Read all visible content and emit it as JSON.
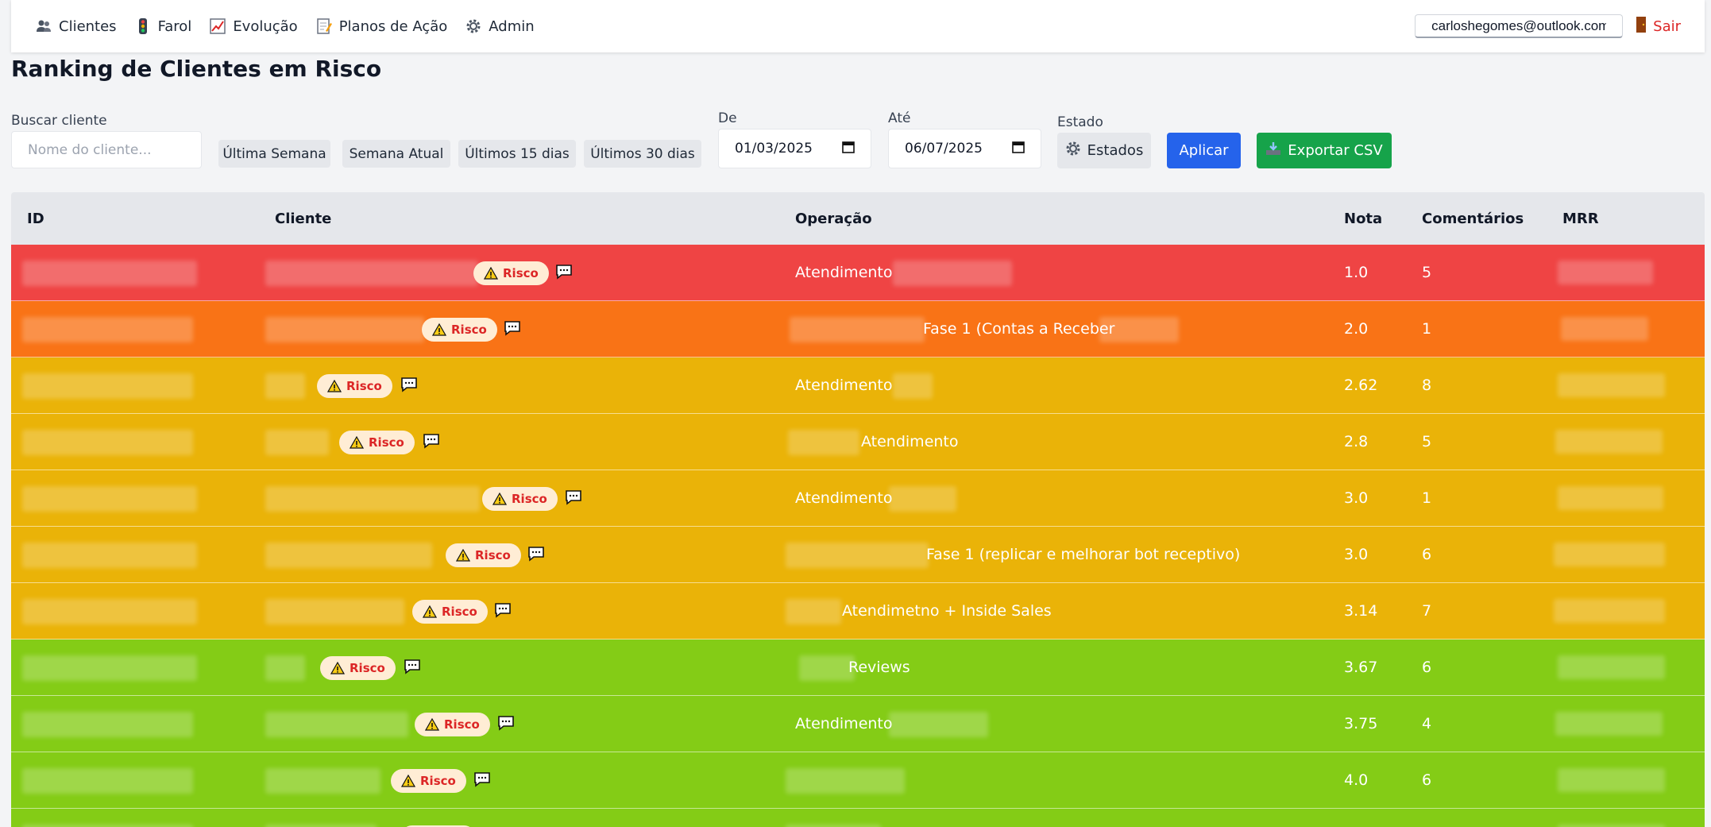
{
  "nav": {
    "items": [
      {
        "label": "Clientes",
        "icon": "users-icon"
      },
      {
        "label": "Farol",
        "icon": "traffic-light-icon"
      },
      {
        "label": "Evolução",
        "icon": "chart-icon"
      },
      {
        "label": "Planos de Ação",
        "icon": "memo-icon"
      },
      {
        "label": "Admin",
        "icon": "gear-icon"
      }
    ],
    "user_email": "carloshegomes@outlook.com",
    "logout_label": "Sair"
  },
  "page": {
    "title": "Ranking de Clientes em Risco"
  },
  "filters": {
    "search_label": "Buscar cliente",
    "search_placeholder": "Nome do cliente...",
    "quick_ranges": [
      "Última Semana",
      "Semana Atual",
      "Últimos 15 dias",
      "Últimos 30 dias"
    ],
    "from_label": "De",
    "from_value": "01/03/2025",
    "to_label": "Até",
    "to_value": "06/07/2025",
    "state_label": "Estado",
    "state_button": "Estados",
    "apply_label": "Aplicar",
    "export_label": "Exportar CSV"
  },
  "table": {
    "columns": [
      "ID",
      "Cliente",
      "Operação",
      "Nota",
      "Comentários",
      "MRR"
    ],
    "risk_label": "Risco",
    "rows": [
      {
        "operation": "Atendimento",
        "score": "1.0",
        "comments": "5",
        "color": "#ef4444"
      },
      {
        "operation": "Fase 1 (Contas a Receber",
        "score": "2.0",
        "comments": "1",
        "color": "#f97316"
      },
      {
        "operation": "Atendimento",
        "score": "2.62",
        "comments": "8",
        "color": "#eab308"
      },
      {
        "operation": "Atendimento",
        "score": "2.8",
        "comments": "5",
        "color": "#eab308"
      },
      {
        "operation": "Atendimento",
        "score": "3.0",
        "comments": "1",
        "color": "#eab308"
      },
      {
        "operation": "Fase 1 (replicar e melhorar bot receptivo)",
        "score": "3.0",
        "comments": "6",
        "color": "#eab308"
      },
      {
        "operation": "Atendimetno + Inside Sales",
        "score": "3.14",
        "comments": "7",
        "color": "#eab308"
      },
      {
        "operation": "Reviews",
        "score": "3.67",
        "comments": "6",
        "color": "#84cc16"
      },
      {
        "operation": "Atendimento",
        "score": "3.75",
        "comments": "4",
        "color": "#84cc16"
      },
      {
        "operation": "",
        "score": "4.0",
        "comments": "6",
        "color": "#84cc16"
      },
      {
        "operation": "",
        "score": "",
        "comments": "",
        "color": "#84cc16"
      }
    ]
  },
  "colors": {
    "accent_blue": "#2563eb",
    "export_green": "#16a34a",
    "risk_red": "#ef4444",
    "risk_orange": "#f97316",
    "risk_yellow": "#eab308",
    "risk_lime": "#84cc16"
  }
}
